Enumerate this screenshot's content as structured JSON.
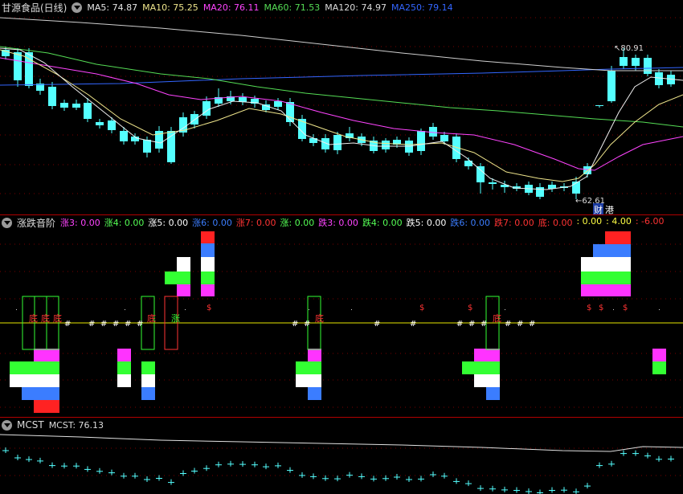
{
  "price_panel": {
    "title": "甘源食品(日线)",
    "indicators": [
      {
        "label": "MA5: 74.87",
        "color": "#e6e6e6"
      },
      {
        "label": "MA10: 75.25",
        "color": "#f0e68c"
      },
      {
        "label": "MA20: 76.11",
        "color": "#ff44ff"
      },
      {
        "label": "MA60: 71.53",
        "color": "#55dd55"
      },
      {
        "label": "MA120: 74.97",
        "color": "#dcdcdc"
      },
      {
        "label": "MA250: 79.14",
        "color": "#3366ff"
      }
    ],
    "high_label": "80.91",
    "low_label": "62.61",
    "tag_cai": "财",
    "tag_gang": "港"
  },
  "signal_panel": {
    "title": "涨跌音阶",
    "indicators": [
      {
        "label": "涨3: 0.00",
        "color": "#ff44ff"
      },
      {
        "label": "涨4: 0.00",
        "color": "#55ff55"
      },
      {
        "label": "涨5: 0.00",
        "color": "#ffffff"
      },
      {
        "label": "涨6: 0.00",
        "color": "#3b7dff"
      },
      {
        "label": "涨7: 0.00",
        "color": "#ff3333"
      },
      {
        "label": "涨: 0.00",
        "color": "#55ff55"
      },
      {
        "label": "跌3: 0.00",
        "color": "#ff44ff"
      },
      {
        "label": "跌4: 0.00",
        "color": "#55ff55"
      },
      {
        "label": "跌5: 0.00",
        "color": "#ffffff"
      },
      {
        "label": "跌6: 0.00",
        "color": "#3b7dff"
      },
      {
        "label": "跌7: 0.00",
        "color": "#ff3333"
      },
      {
        "label": "底: 0.00",
        "color": "#ff3333"
      },
      {
        "label": ": 0.00",
        "color": "#ffff44"
      },
      {
        "label": ": 4.00",
        "color": "#ffff44"
      },
      {
        "label": ": -6.00",
        "color": "#ff3333"
      }
    ],
    "di": "底",
    "zhang": "涨",
    "hash": "#",
    "dollar": "$"
  },
  "mcst_panel": {
    "title": "MCST",
    "indicators": [
      {
        "label": "MCST: 76.13",
        "color": "#dcdcdc"
      }
    ]
  },
  "colors": {
    "up": "#ff3333",
    "down": "#54ffff",
    "grid": "#7a0000"
  }
}
